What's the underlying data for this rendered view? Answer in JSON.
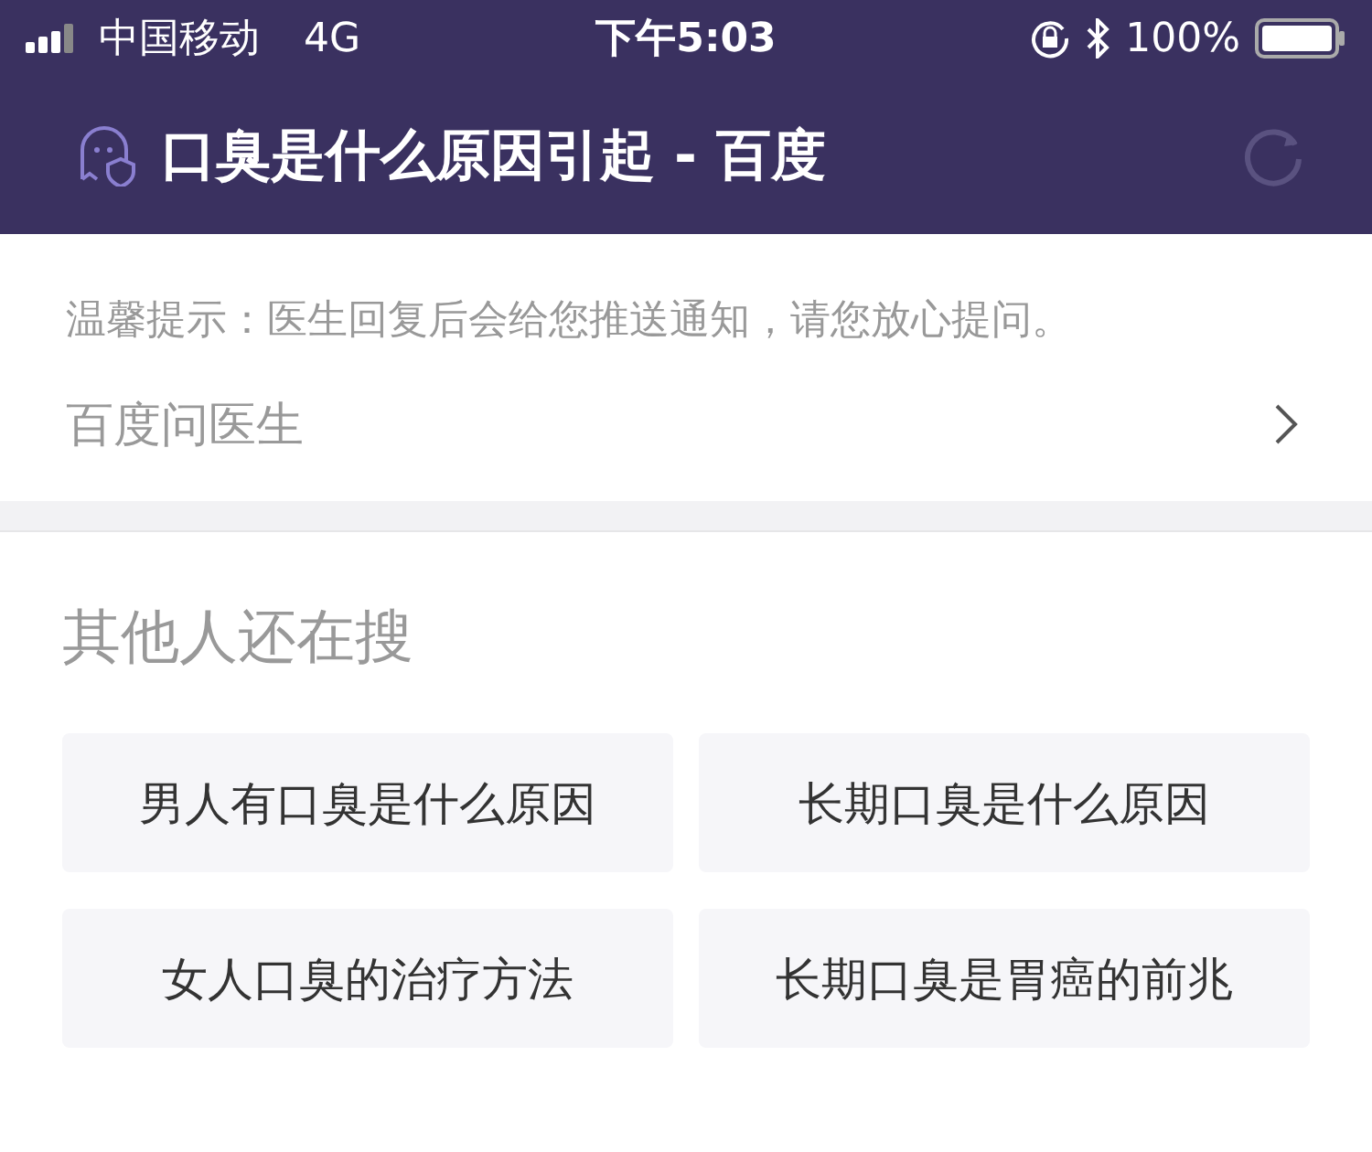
{
  "status_bar": {
    "carrier": "中国移动",
    "network": "4G",
    "time": "下午5:03",
    "battery": "100%"
  },
  "header": {
    "title": "口臭是什么原因引起 - 百度"
  },
  "notice": {
    "hint": "温馨提示：医生回复后会给您推送通知，请您放心提问。",
    "link": "百度问医生"
  },
  "related": {
    "title": "其他人还在搜",
    "items": [
      {
        "label": "男人有口臭是什么原因"
      },
      {
        "label": "长期口臭是什么原因"
      },
      {
        "label": "女人口臭的治疗方法"
      },
      {
        "label": "长期口臭是胃癌的前兆"
      }
    ]
  }
}
